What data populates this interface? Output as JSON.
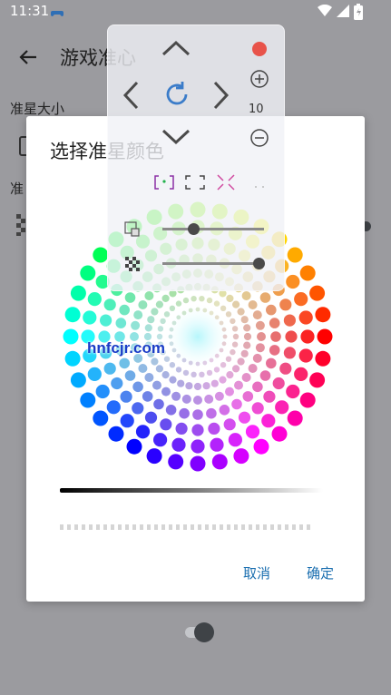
{
  "status_bar": {
    "time": "11:31"
  },
  "app_bar": {
    "title": "游戏准心"
  },
  "background": {
    "label_size": "准星大小",
    "label_style": "准"
  },
  "dialog": {
    "title": "选择准星颜色",
    "cancel_label": "取消",
    "ok_label": "确定",
    "brightness": 0.0,
    "alpha": 1.0
  },
  "overlay_panel": {
    "zoom_value": "10",
    "size_slider_value": 0.3,
    "alpha_slider_value": 0.95,
    "record_color": "#e8534a",
    "crosshair_styles": [
      "crosshair-dot-icon",
      "crosshair-bracket-icon",
      "crosshair-x-icon",
      "crosshair-dots-icon"
    ]
  },
  "watermark": "hnfcjr.com"
}
